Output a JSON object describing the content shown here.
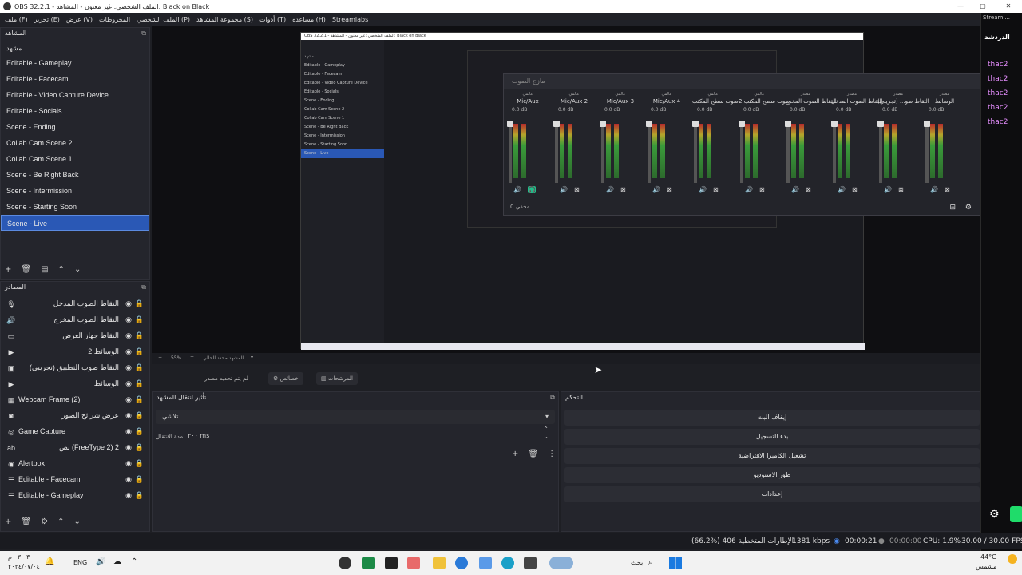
{
  "window": {
    "title": "OBS 32.2.1 - الملف الشخصي: غير معنون - المشاهد: Black on Black"
  },
  "menu": [
    "ملف (F)",
    "تحرير (E)",
    "عرض (V)",
    "المخروطات",
    "الملف الشخصي (P)",
    "مجموعة المشاهد (S)",
    "أدوات (T)",
    "مساعدة (H)",
    "Streamlabs"
  ],
  "scenes": {
    "title": "المشاهد",
    "items": [
      {
        "label": "مشهد",
        "active": false
      },
      {
        "label": "Editable - Gameplay",
        "active": false
      },
      {
        "label": "Editable - Facecam",
        "active": false
      },
      {
        "label": "Editable - Video Capture Device",
        "active": false
      },
      {
        "label": "Editable - Socials",
        "active": false
      },
      {
        "label": "Scene - Ending",
        "active": false
      },
      {
        "label": "Collab Cam Scene 2",
        "active": false
      },
      {
        "label": "Collab Cam Scene 1",
        "active": false
      },
      {
        "label": "Scene - Be Right Back",
        "active": false
      },
      {
        "label": "Scene - Intermission",
        "active": false
      },
      {
        "label": "Scene - Starting Soon",
        "active": false
      },
      {
        "label": "Scene - Live",
        "active": true
      }
    ]
  },
  "sources": {
    "title": "المصادر",
    "items": [
      {
        "icon": "mic-icon",
        "glyph": "🎙",
        "label": "التقاط الصوت المدخل",
        "rtl": true
      },
      {
        "icon": "speaker-icon",
        "glyph": "🔊",
        "label": "التقاط الصوت المخرج",
        "rtl": true
      },
      {
        "icon": "monitor-icon",
        "glyph": "▭",
        "label": "التقاط جهاز العرض",
        "rtl": true
      },
      {
        "icon": "play-icon",
        "glyph": "▶",
        "label": "الوسائط 2",
        "rtl": true
      },
      {
        "icon": "window-icon",
        "glyph": "▣",
        "label": "التقاط صوت التطبيق (تجريبي)",
        "rtl": true
      },
      {
        "icon": "play-icon",
        "glyph": "▶",
        "label": "الوسائط",
        "rtl": true
      },
      {
        "icon": "webcam-icon",
        "glyph": "▦",
        "label": "Webcam Frame (2)",
        "rtl": false
      },
      {
        "icon": "camera-icon",
        "glyph": "◙",
        "label": "عرض شرائح الصور",
        "rtl": true
      },
      {
        "icon": "gamepad-icon",
        "glyph": "◎",
        "label": "Game Capture",
        "rtl": false
      },
      {
        "icon": "text-icon",
        "glyph": "ab",
        "label": "نص (FreeType 2) 2",
        "rtl": true
      },
      {
        "icon": "browser-icon",
        "glyph": "◉",
        "label": "Alertbox",
        "rtl": false
      },
      {
        "icon": "list-icon",
        "glyph": "☰",
        "label": "Editable - Facecam",
        "rtl": false
      },
      {
        "icon": "list-icon",
        "glyph": "☰",
        "label": "Editable - Gameplay",
        "rtl": false
      }
    ]
  },
  "mixer": {
    "title": "مازج الصوت",
    "channels": [
      {
        "tag": "عالمي",
        "name": "Mic/Aux",
        "db": "0.0 dB",
        "highlight": true
      },
      {
        "tag": "عالمي",
        "name": "Mic/Aux 2",
        "db": "0.0 dB"
      },
      {
        "tag": "عالمي",
        "name": "Mic/Aux 3",
        "db": "0.0 dB"
      },
      {
        "tag": "عالمي",
        "name": "Mic/Aux 4",
        "db": "0.0 dB"
      },
      {
        "tag": "عالمي",
        "name": "صوت سطح المكتب",
        "db": "0.0 dB"
      },
      {
        "tag": "عالمي",
        "name": "صوت سطح المكتب 2",
        "db": "0.0 dB"
      },
      {
        "tag": "مصدر",
        "name": "التقاط الصوت المخرج",
        "db": "0.0 dB"
      },
      {
        "tag": "مصدر",
        "name": "التقاط الصوت المدخل",
        "db": "0.0 dB"
      },
      {
        "tag": "مصدر",
        "name": "التقاط صو... (تجريبي)",
        "db": "0.0 dB"
      },
      {
        "tag": "مصدر",
        "name": "الوسائط",
        "db": "0.0 dB"
      }
    ],
    "footer": "مخفي 0"
  },
  "preview": {
    "zoom": "55%",
    "scene_label": "المشهد محدد الحالي"
  },
  "props_bar": {
    "no_source": "لم يتم تحديد مصدر",
    "properties": "خصائص",
    "filters": "المرشحات"
  },
  "transitions": {
    "title": "تأثير انتقال المشهد",
    "selected": "تلاشي",
    "duration_label": "مدة الانتقال",
    "duration_value": "٣٠٠ ms"
  },
  "controls": {
    "title": "التحكم",
    "buttons": [
      "إيقاف البث",
      "بدء التسجيل",
      "تشغيل الكاميرا الافتراضية",
      "طور الاستوديو",
      "إعدادات"
    ]
  },
  "status": {
    "dropped": "الإطارات المتخطية 406 (%66.2)",
    "bitrate": "1381 kbps",
    "stream_time": "00:00:21",
    "rec_time": "00:00:00",
    "cpu": "CPU: 1.9%",
    "fps": "30.00 / 30.00 FPS"
  },
  "chat": {
    "header": "Streaml...",
    "title": "الدردشة",
    "lines": [
      "thac2",
      "thac2",
      "thac2",
      "thac2",
      "thac2"
    ]
  },
  "taskbar": {
    "time": "٠٣:٠٣ م",
    "date": "٢٠٢٤/٠٧/٠٤",
    "lang": "ENG",
    "search": "بحث",
    "weather": "44°C",
    "weather_label": "مشمس"
  },
  "colors": {
    "accent": "#2a58b5",
    "panel": "#24252c",
    "bg": "#1e1f24"
  }
}
